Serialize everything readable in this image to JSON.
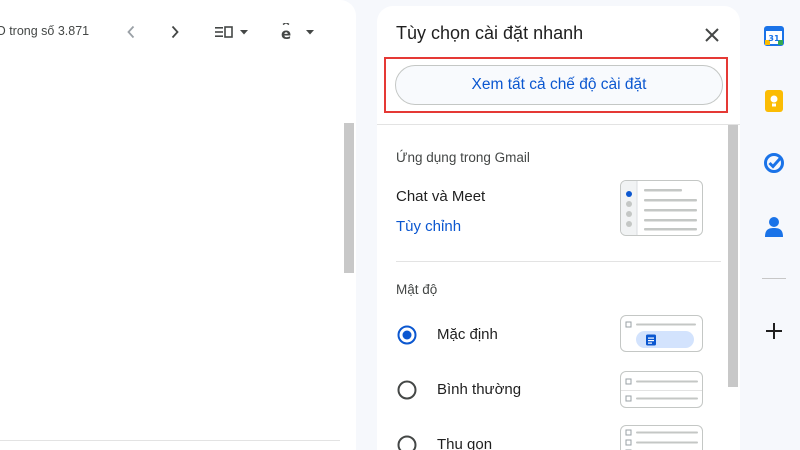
{
  "toolbar": {
    "count_text": "O trong số 3.871",
    "icons": [
      "chevron-left-icon",
      "chevron-right-icon",
      "split-view-icon",
      "input-tools-icon"
    ]
  },
  "quick_settings": {
    "title": "Tùy chọn cài đặt nhanh",
    "see_all_label": "Xem tất cả chế độ cài đặt",
    "apps_section": {
      "heading": "Ứng dụng trong Gmail",
      "item_label": "Chat và Meet",
      "customize_link": "Tùy chỉnh"
    },
    "density_section": {
      "heading": "Mật độ",
      "options": [
        {
          "label": "Mặc định",
          "selected": true
        },
        {
          "label": "Bình thường",
          "selected": false
        },
        {
          "label": "Thu gọn",
          "selected": false
        }
      ]
    }
  },
  "side_panel": {
    "icons": [
      "google-calendar-icon",
      "google-keep-icon",
      "google-tasks-icon",
      "google-contacts-icon",
      "add-app-icon"
    ],
    "calendar_day": "31"
  },
  "colors": {
    "accent_blue": "#0b57d0",
    "highlight_red": "#e53935",
    "keep_yellow": "#fbbc04",
    "tasks_blue": "#1a73e8"
  }
}
